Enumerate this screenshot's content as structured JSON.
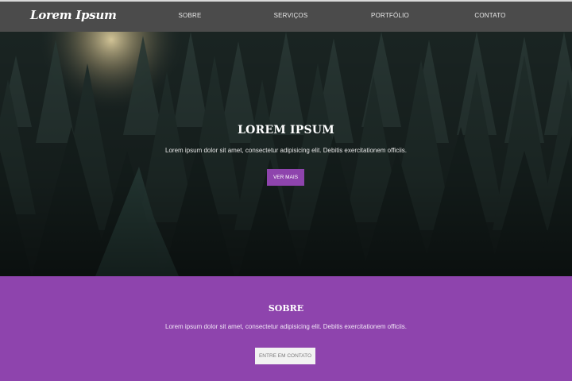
{
  "navbar": {
    "brand": "Lorem Ipsum",
    "links": [
      "SOBRE",
      "SERVIÇOS",
      "PORTFÓLIO",
      "CONTATO"
    ],
    "background": "#4b4b4b"
  },
  "hero": {
    "title": "LOREM IPSUM",
    "text": "Lorem ipsum dolor sit amet, consectetur adipisicing elit. Debitis exercitationem officiis.",
    "button_label": "VER MAIS",
    "button_color": "#8e44ad"
  },
  "about": {
    "title": "SOBRE",
    "text": "Lorem ipsum dolor sit amet, consectetur adipisicing elit. Debitis exercitationem officiis.",
    "button_label": "ENTRE EM CONTATO",
    "background": "#8e44ad"
  }
}
